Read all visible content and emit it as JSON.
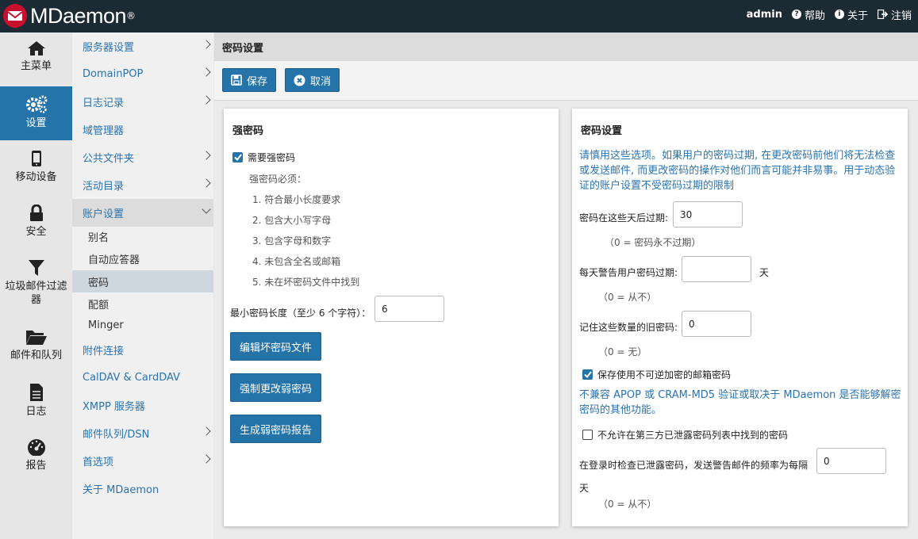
{
  "app": {
    "brand": "MDaemon",
    "reg_mark": "®"
  },
  "topnav": {
    "user": "admin",
    "help": "帮助",
    "about": "关于",
    "logout": "注销"
  },
  "iconnav": {
    "home": "主菜单",
    "settings": "设置",
    "mobile": "移动设备",
    "security": "安全",
    "spam": "垃圾邮件过滤器",
    "queues": "邮件和队列",
    "logs": "日志",
    "reports": "报告"
  },
  "submenu": {
    "server": "服务器设置",
    "domainpop": "DomainPOP",
    "logging": "日志记录",
    "domain_manager": "域管理器",
    "public_folders": "公共文件夹",
    "active_directory": "活动目录",
    "account_settings": "账户设置",
    "alias": "别名",
    "autoresponder": "自动应答器",
    "password": "密码",
    "quota": "配额",
    "minger": "Minger",
    "attachment_linking": "附件连接",
    "caldav": "CalDAV & CardDAV",
    "xmpp": "XMPP 服务器",
    "queues_dsn": "邮件队列/DSN",
    "preferences": "首选项",
    "about": "关于 MDaemon"
  },
  "page": {
    "title": "密码设置"
  },
  "toolbar": {
    "save": "保存",
    "cancel": "取消"
  },
  "strong": {
    "title": "强密码",
    "require_label": "需要强密码",
    "require_checked": true,
    "must_text": "强密码必须：",
    "rules": [
      "1. 符合最小长度要求",
      "2. 包含大小写字母",
      "3. 包含字母和数字",
      "4. 未包含全名或邮箱",
      "5. 未在坏密码文件中找到"
    ],
    "min_len_label": "最小密码长度（至少 6 个字符）：",
    "min_len_value": "6",
    "btn_edit": "编辑坏密码文件",
    "btn_force": "强制更改弱密码",
    "btn_report": "生成弱密码报告"
  },
  "settings": {
    "title": "密码设置",
    "warning": "请慎用这些选项。如果用户的密码过期, 在更改密码前他们将无法检查或发送邮件, 而更改密码的操作对他们而言可能并非易事。用于动态验证的账户设置不受密码过期的限制",
    "expire_label": "密码在这些天后过期:",
    "expire_value": "30",
    "expire_hint": "（0 = 密码永不过期）",
    "warn_label": "每天警告用户密码过期:",
    "warn_value": "",
    "warn_unit": "天",
    "warn_hint": "（0 = 从不）",
    "remember_label": "记住这些数量的旧密码:",
    "remember_value": "0",
    "remember_hint": "（0 = 无）",
    "reversible_label": "保存使用不可逆加密的邮箱密码",
    "reversible_checked": true,
    "reversible_note": "不兼容 APOP 或 CRAM-MD5 验证或取决于 MDaemon 是否能够解密密码的其他功能。",
    "breached_label": "不允许在第三方已泄露密码列表中找到的密码",
    "breached_checked": false,
    "login_check_label": "在登录时检查已泄露密码，发送警告邮件的频率为每隔",
    "login_check_value": "0",
    "login_check_unit": "天",
    "login_check_hint": "（0 = 从不）"
  }
}
